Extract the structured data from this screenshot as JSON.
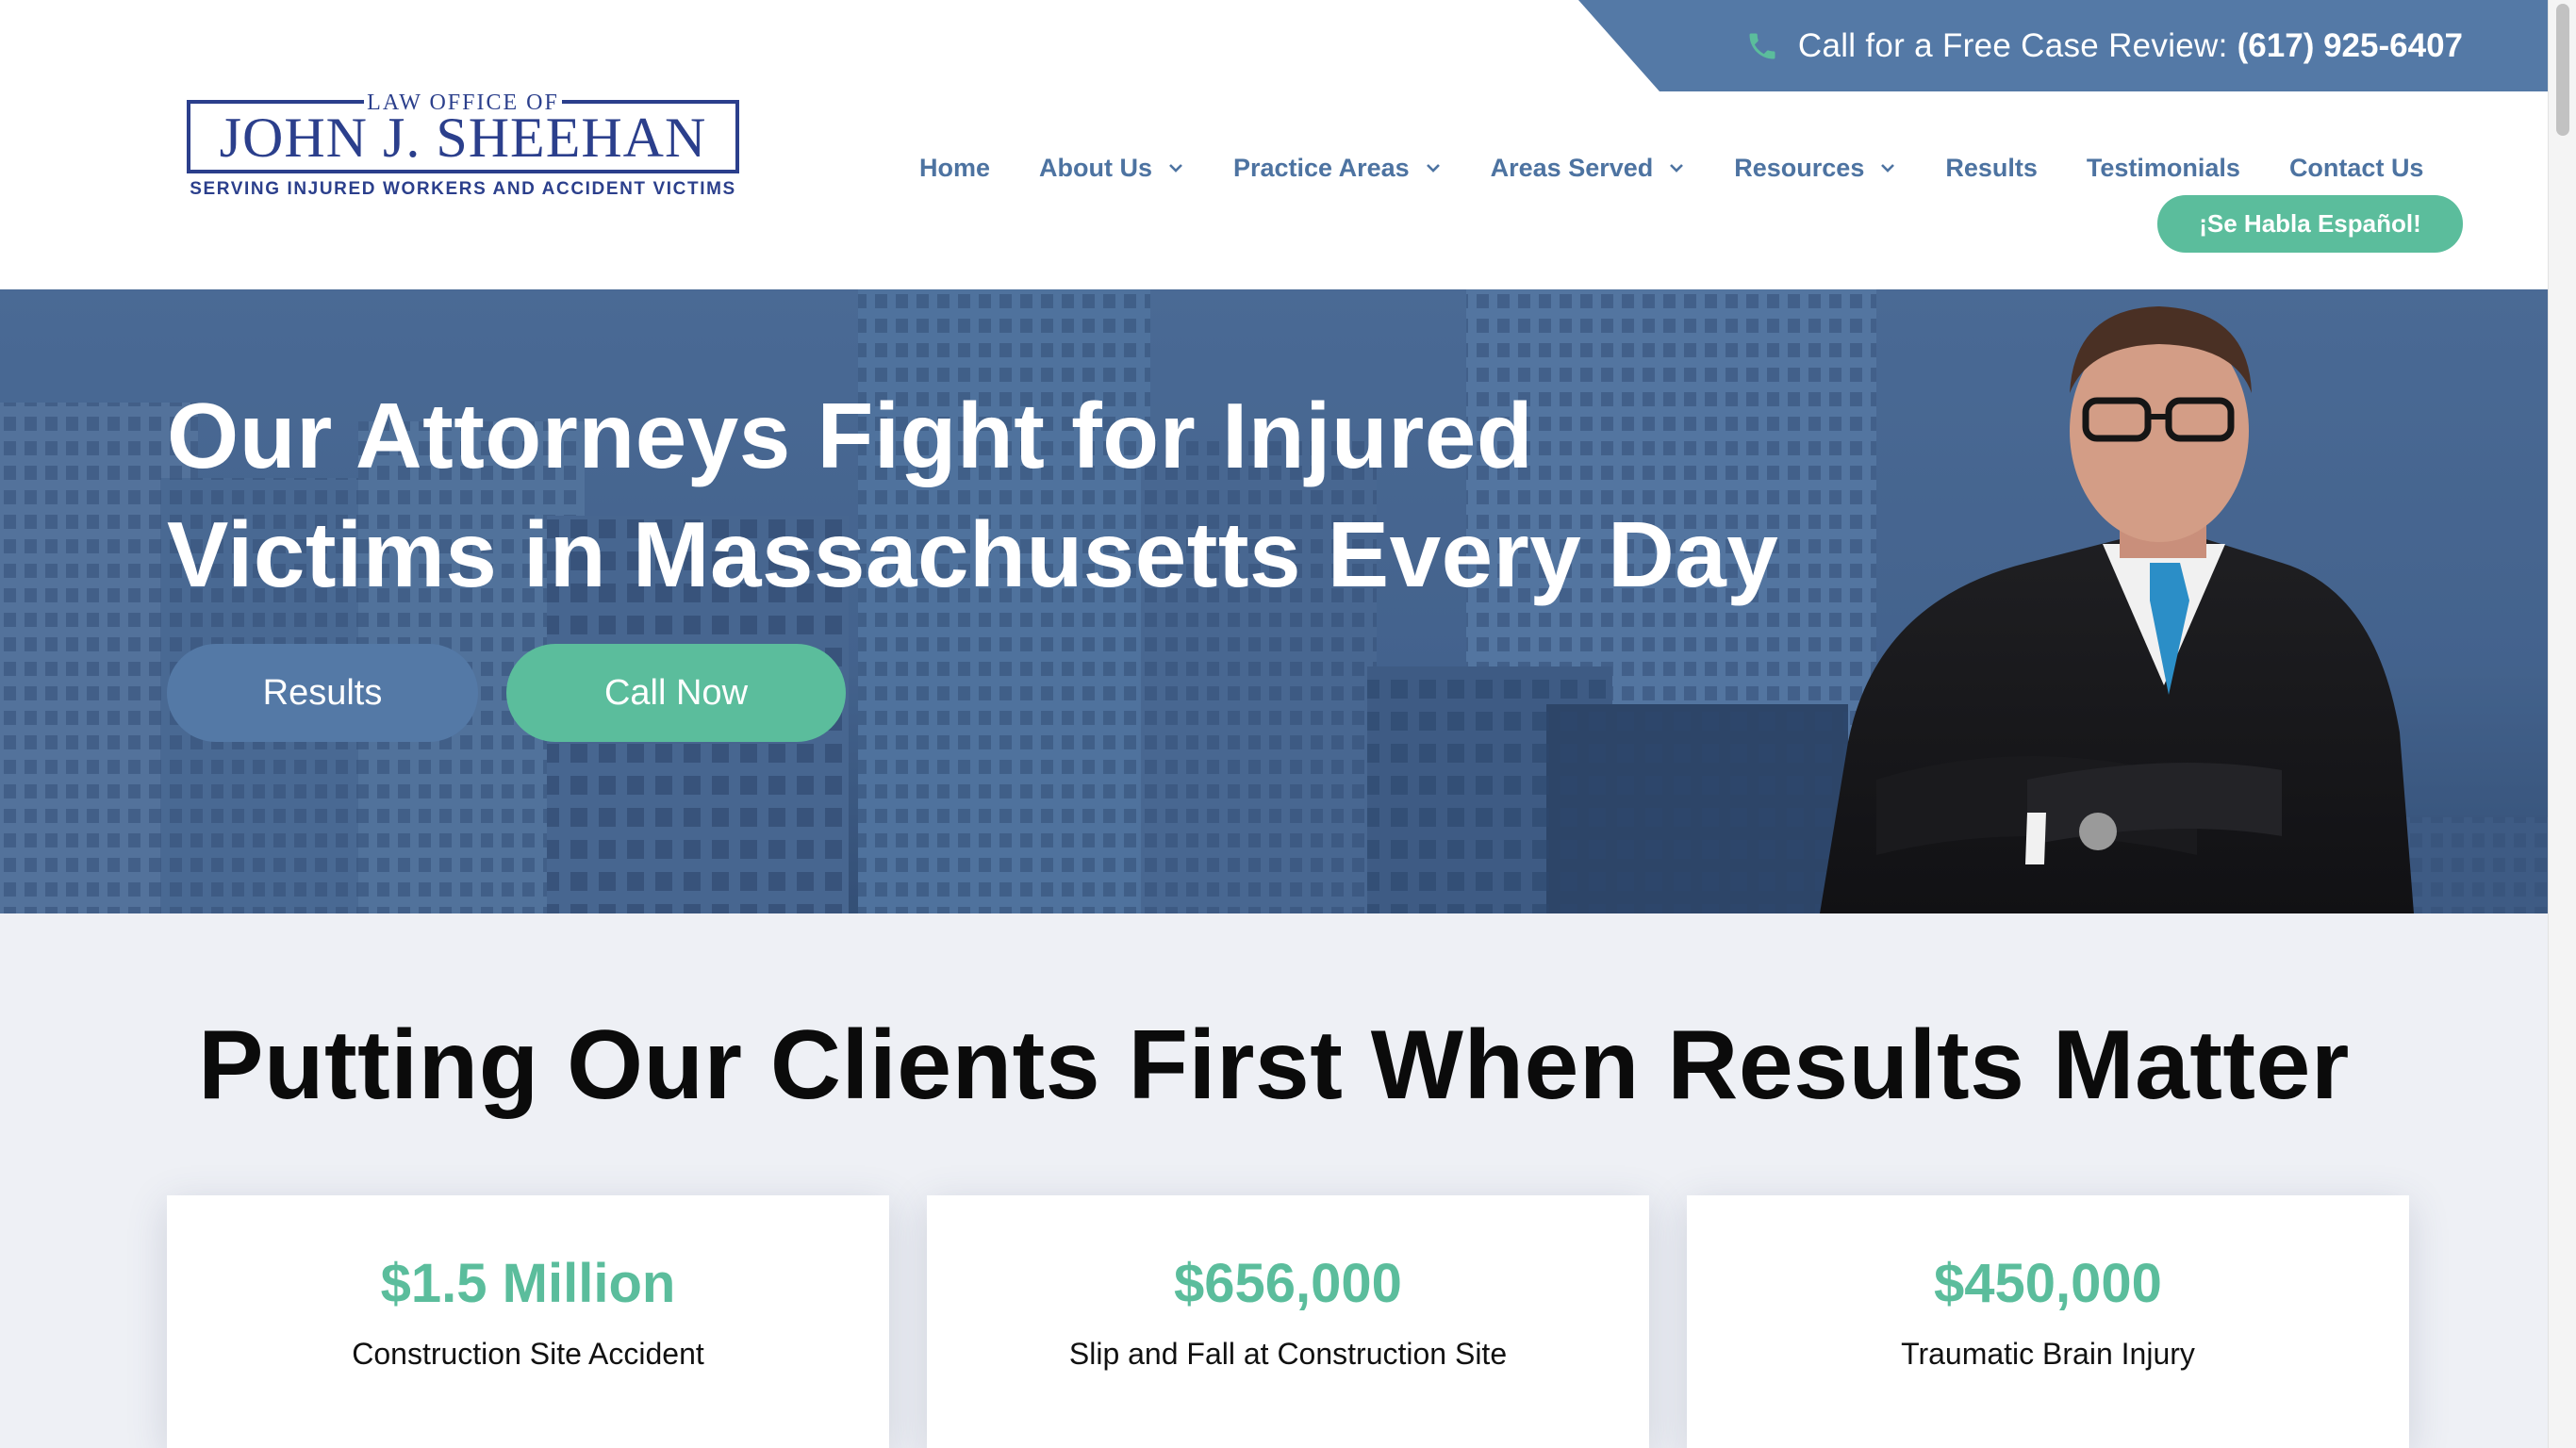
{
  "colors": {
    "brand_blue": "#5479a6",
    "nav_blue": "#4d73a1",
    "accent_green": "#5bbd9c",
    "logo_navy": "#2b3f8c",
    "section_bg": "#eef0f5"
  },
  "topbar": {
    "phone_icon": "phone-icon",
    "call_label": "Call for a Free Case Review:",
    "phone_number": "(617) 925-6407"
  },
  "logo": {
    "top": "LAW OFFICE OF",
    "name": "JOHN J. SHEEHAN",
    "tagline": "SERVING INJURED WORKERS AND ACCIDENT VICTIMS"
  },
  "nav": {
    "items": [
      {
        "label": "Home",
        "dropdown": false
      },
      {
        "label": "About Us",
        "dropdown": true
      },
      {
        "label": "Practice Areas",
        "dropdown": true
      },
      {
        "label": "Areas Served",
        "dropdown": true
      },
      {
        "label": "Resources",
        "dropdown": true
      },
      {
        "label": "Results",
        "dropdown": false
      },
      {
        "label": "Testimonials",
        "dropdown": false
      },
      {
        "label": "Contact Us",
        "dropdown": false
      }
    ],
    "espanol_button": "¡Se Habla Español!"
  },
  "hero": {
    "title_line1": "Our Attorneys Fight for Injured",
    "title_line2": "Victims in Massachusetts Every Day",
    "results_button": "Results",
    "call_button": "Call Now"
  },
  "results": {
    "heading": "Putting Our Clients First When Results Matter",
    "cards": [
      {
        "amount": "$1.5 Million",
        "case": "Construction Site Accident"
      },
      {
        "amount": "$656,000",
        "case": "Slip and Fall at Construction Site"
      },
      {
        "amount": "$450,000",
        "case": "Traumatic Brain Injury"
      }
    ]
  }
}
